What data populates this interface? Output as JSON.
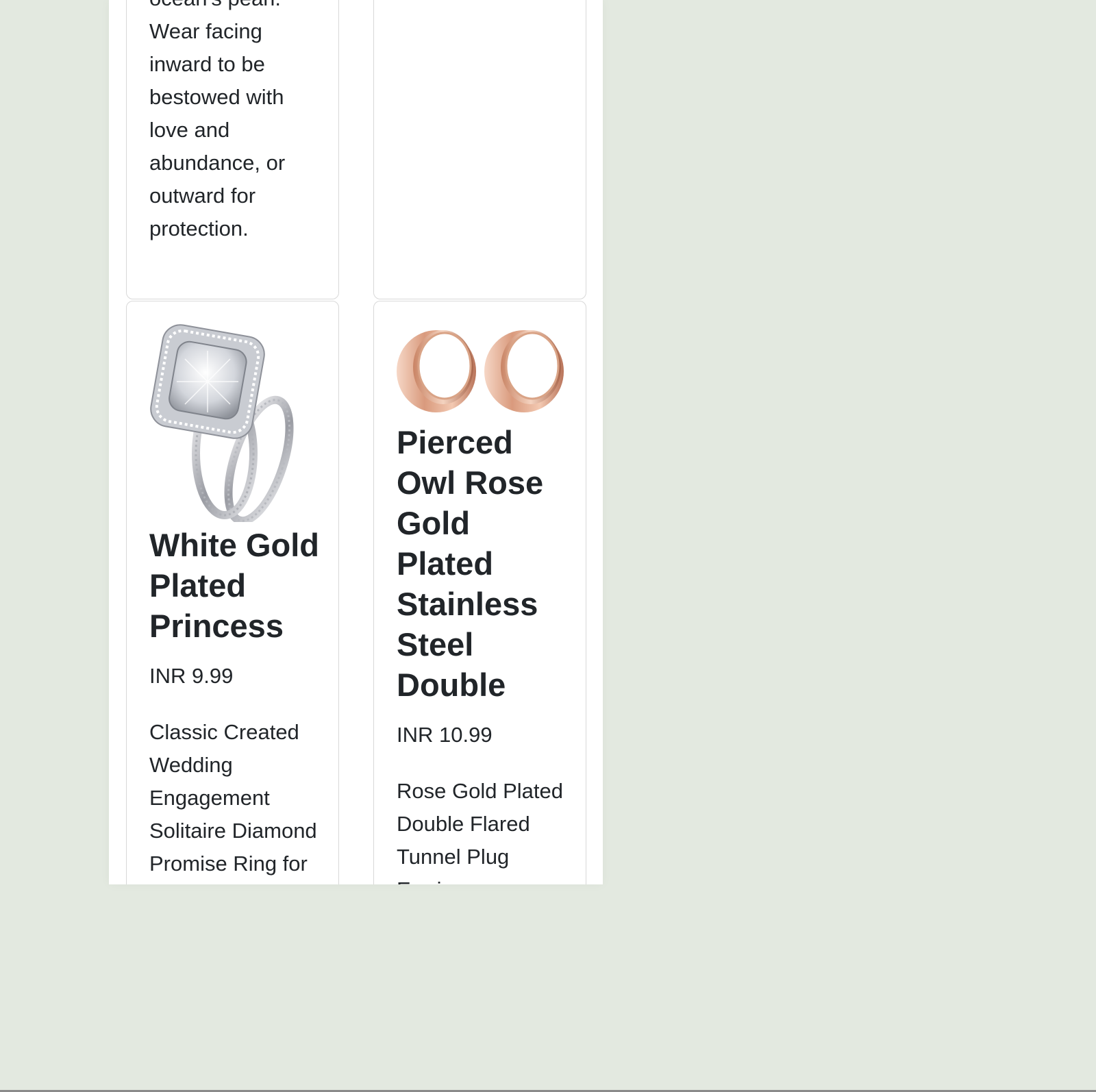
{
  "products": [
    {
      "description": "ocean's pearl. Wear facing inward to be bestowed with love and abundance, or outward for protection."
    },
    {
      "description": ""
    },
    {
      "image": "diamond-ring-set",
      "title": "White Gold Plated Princess",
      "price": "INR 9.99",
      "description": "Classic Created Wedding Engagement Solitaire Diamond Promise Ring for"
    },
    {
      "image": "rose-gold-tunnel-plugs",
      "title": "Pierced Owl Rose Gold Plated Stainless Steel Double",
      "price": "INR 10.99",
      "description": "Rose Gold Plated Double Flared Tunnel Plug Earrings"
    }
  ],
  "colors": {
    "page_background": "#e3e9e0",
    "card_border": "#d8d8d8",
    "text": "#212529",
    "rose_gold": "#d99a7d"
  }
}
